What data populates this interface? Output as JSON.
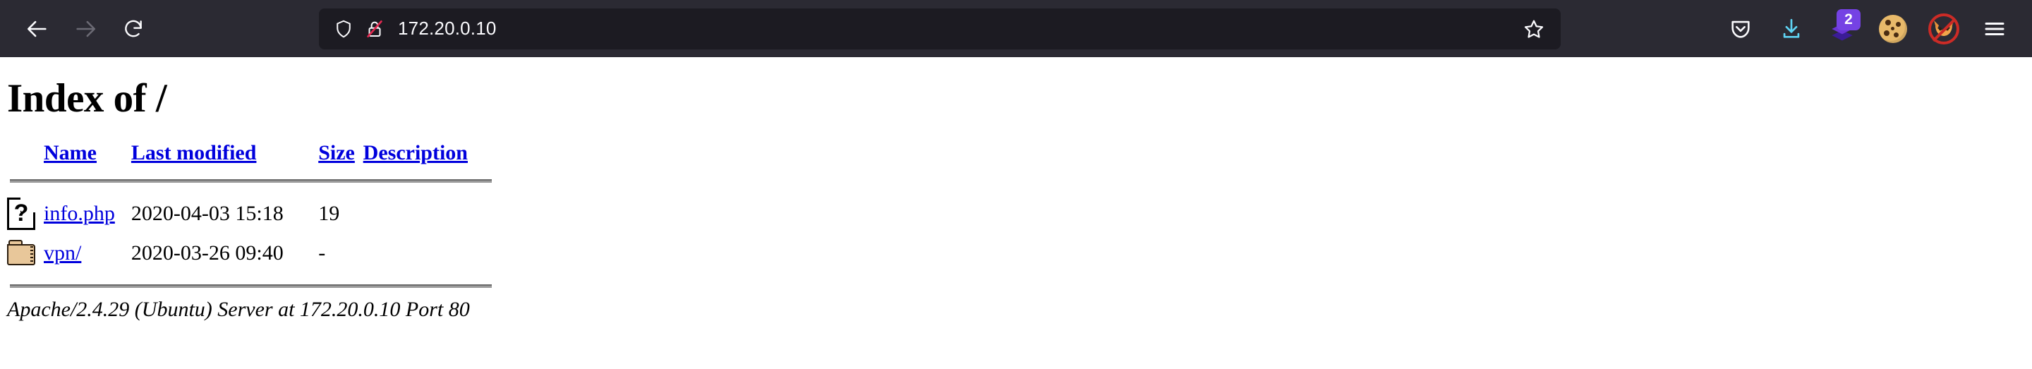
{
  "browser": {
    "nav": {
      "back_label": "Back",
      "forward_label": "Forward",
      "reload_label": "Reload"
    },
    "urlbar": {
      "url": "172.20.0.10",
      "placeholder": "Search with Google or enter address",
      "shield_icon": "shield-icon",
      "security_icon": "lock-crossed-out-icon",
      "bookmark_icon": "star-outline-icon"
    },
    "toolbar_right": [
      {
        "name": "pocket-icon",
        "label": "Save to Pocket"
      },
      {
        "name": "downloads-icon",
        "label": "Downloads"
      },
      {
        "name": "extension-icon",
        "label": "Extension",
        "badge": "2"
      },
      {
        "name": "cookie-icon",
        "label": "Cookie manager"
      },
      {
        "name": "no-fox-icon",
        "label": "Disable tracking"
      },
      {
        "name": "app-menu-icon",
        "label": "Open application menu"
      }
    ],
    "colors": {
      "toolbar_bg": "#2b2a33",
      "urlbar_bg": "#1c1b22",
      "toolbar_fg": "#fbfbfe",
      "badge_bg": "#7542e4",
      "download_accent": "#5fd4f4"
    }
  },
  "page": {
    "title": "Index of /",
    "columns": [
      "Name",
      "Last modified",
      "Size",
      "Description"
    ],
    "rows": [
      {
        "icon": "unknown-file-icon",
        "name": "info.php",
        "last_modified": "2020-04-03 15:18",
        "size": "19",
        "description": ""
      },
      {
        "icon": "folder-icon",
        "name": "vpn/",
        "last_modified": "2020-03-26 09:40",
        "size": "-",
        "description": ""
      }
    ],
    "server_signature": "Apache/2.4.29 (Ubuntu) Server at 172.20.0.10 Port 80",
    "colors": {
      "link": "#0000dd",
      "text": "#000000",
      "background": "#ffffff",
      "rule": "#9a9a9a"
    }
  }
}
